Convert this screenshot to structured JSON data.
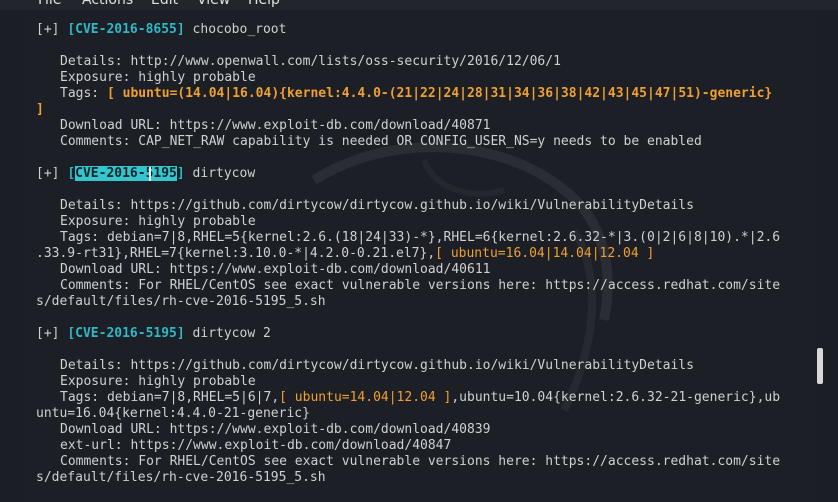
{
  "menu": [
    "File",
    "Actions",
    "Edit",
    "View",
    "Help"
  ],
  "entries": [
    {
      "prefix": "[+] ",
      "cve": "[CVE-2016-8655]",
      "name": " chocobo_root",
      "details": "Details: http://www.openwall.com/lists/oss-security/2016/12/06/1",
      "exposure": "Exposure: highly probable",
      "tags_label": "Tags: ",
      "tags_orange_1": "[ ubuntu=(14.04|16.04){kernel:4.4.0-(21|22|24|28|31|34|36|38|42|43|45|47|51)-generic}",
      "tags_orange_2": "]",
      "download": "Download URL: https://www.exploit-db.com/download/40871",
      "comments": "Comments: CAP_NET_RAW capability is needed OR CONFIG_USER_NS=y needs to be enabled"
    },
    {
      "prefix": "[+] ",
      "cve_bracket_open": "[",
      "cve_highlight": "CVE-2016-5195",
      "cve_bracket_close": "]",
      "name": " dirtycow",
      "details": "Details: https://github.com/dirtycow/dirtycow.github.io/wiki/VulnerabilityDetails",
      "exposure": "Exposure: highly probable",
      "tags_line_1": "Tags: debian=7|8,RHEL=5{kernel:2.6.(18|24|33)-*},RHEL=6{kernel:2.6.32-*|3.(0|2|6|8|10).*|2.6",
      "tags_line_2_plain": ".33.9-rt31},RHEL=7{kernel:3.10.0-*|4.2.0-0.21.el7},",
      "tags_line_2_orange": "[ ubuntu=16.04|14.04|12.04 ]",
      "download": "Download URL: https://www.exploit-db.com/download/40611",
      "comments_1": "Comments: For RHEL/CentOS see exact vulnerable versions here: https://access.redhat.com/site",
      "comments_2": "s/default/files/rh-cve-2016-5195_5.sh"
    },
    {
      "prefix": "[+] ",
      "cve": "[CVE-2016-5195]",
      "name": " dirtycow 2",
      "details": "Details: https://github.com/dirtycow/dirtycow.github.io/wiki/VulnerabilityDetails",
      "exposure": "Exposure: highly probable",
      "tags_line_1_a": "Tags: debian=7|8,RHEL=5|6|7,",
      "tags_line_1_orange": "[ ubuntu=14.04|12.04 ]",
      "tags_line_1_b": ",ubuntu=10.04{kernel:2.6.32-21-generic},ub",
      "tags_line_2": "untu=16.04{kernel:4.4.0-21-generic}",
      "download": "Download URL: https://www.exploit-db.com/download/40839",
      "ext_url": "ext-url: https://www.exploit-db.com/download/40847",
      "comments_1": "Comments: For RHEL/CentOS see exact vulnerable versions here: https://access.redhat.com/site",
      "comments_2": "s/default/files/rh-cve-2016-5195_5.sh"
    }
  ],
  "colors": {
    "background": "#1c1f25",
    "text": "#d0d0d0",
    "cve": "#2fb8c8",
    "tags_orange": "#f0a030"
  }
}
